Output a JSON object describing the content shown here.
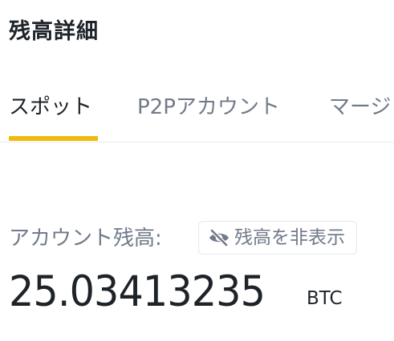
{
  "header": {
    "title": "残高詳細"
  },
  "tabs": [
    {
      "label": "スポット",
      "active": true
    },
    {
      "label": "P2Pアカウント",
      "active": false
    },
    {
      "label": "マージ",
      "active": false
    }
  ],
  "balance": {
    "label": "アカウント残高:",
    "hide_button": {
      "icon": "eye-slash-icon",
      "label": "残高を非表示"
    },
    "amount": "25.03413235",
    "currency": "BTC"
  },
  "colors": {
    "accent": "#f0b90b",
    "text_primary": "#1e2329",
    "text_secondary": "#707a8a"
  }
}
